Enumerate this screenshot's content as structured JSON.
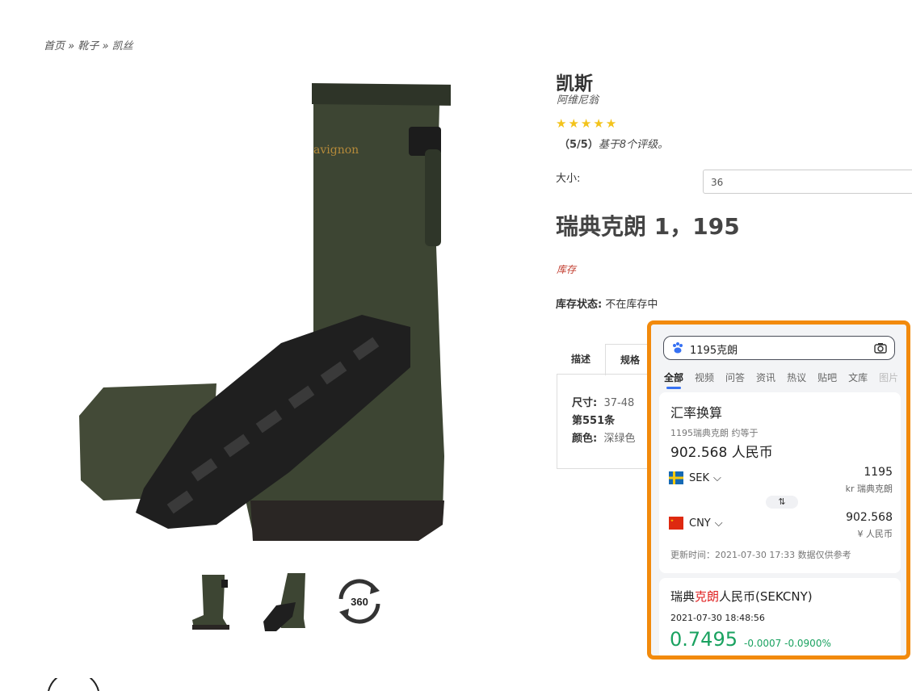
{
  "breadcrumb": {
    "home": "首页",
    "sep": "»",
    "cat": "靴子",
    "current": "凯丝"
  },
  "product": {
    "title": "凯斯",
    "brand": "阿维尼翁",
    "stars": "★★★★★",
    "rating_score": "（5/5）",
    "rating_text": "基于8个评级。",
    "size_label": "大小:",
    "size_value": "36",
    "price": "瑞典克朗 1，195",
    "stock_link": "库存",
    "stock_label": "库存状态:",
    "stock_value": "不在库存中",
    "tabs": [
      "描述",
      "规格"
    ],
    "specs": [
      {
        "k": "尺寸:",
        "v": "37-48"
      },
      {
        "k": "第551条",
        "v": ""
      },
      {
        "k": "颜色:",
        "v": "深绿色"
      }
    ]
  },
  "thumb_360_label": "360",
  "overlay": {
    "query": "1195克朗",
    "nav": [
      "全部",
      "视频",
      "问答",
      "资讯",
      "热议",
      "贴吧",
      "文库",
      "图片"
    ],
    "card_title": "汇率换算",
    "equals_text": "1195瑞典克朗 约等于",
    "result": "902.568 人民币",
    "from_code": "SEK",
    "from_amount": "1195",
    "from_name": "kr 瑞典克朗",
    "to_code": "CNY",
    "to_amount": "902.568",
    "to_name": "¥ 人民币",
    "swap": "⇅",
    "updated": "更新时间：2021-07-30 17:33 数据仅供参考",
    "pair_prefix": "瑞典",
    "pair_red": "克朗",
    "pair_suffix": "人民币(SEKCNY)",
    "pair_time": "2021-07-30 18:48:56",
    "pair_rate": "0.7495",
    "pair_change": "-0.0007  -0.0900%"
  },
  "colors": {
    "overlay_border": "#f28a0c",
    "up_green": "#1aa260",
    "star": "#f3c31b"
  }
}
